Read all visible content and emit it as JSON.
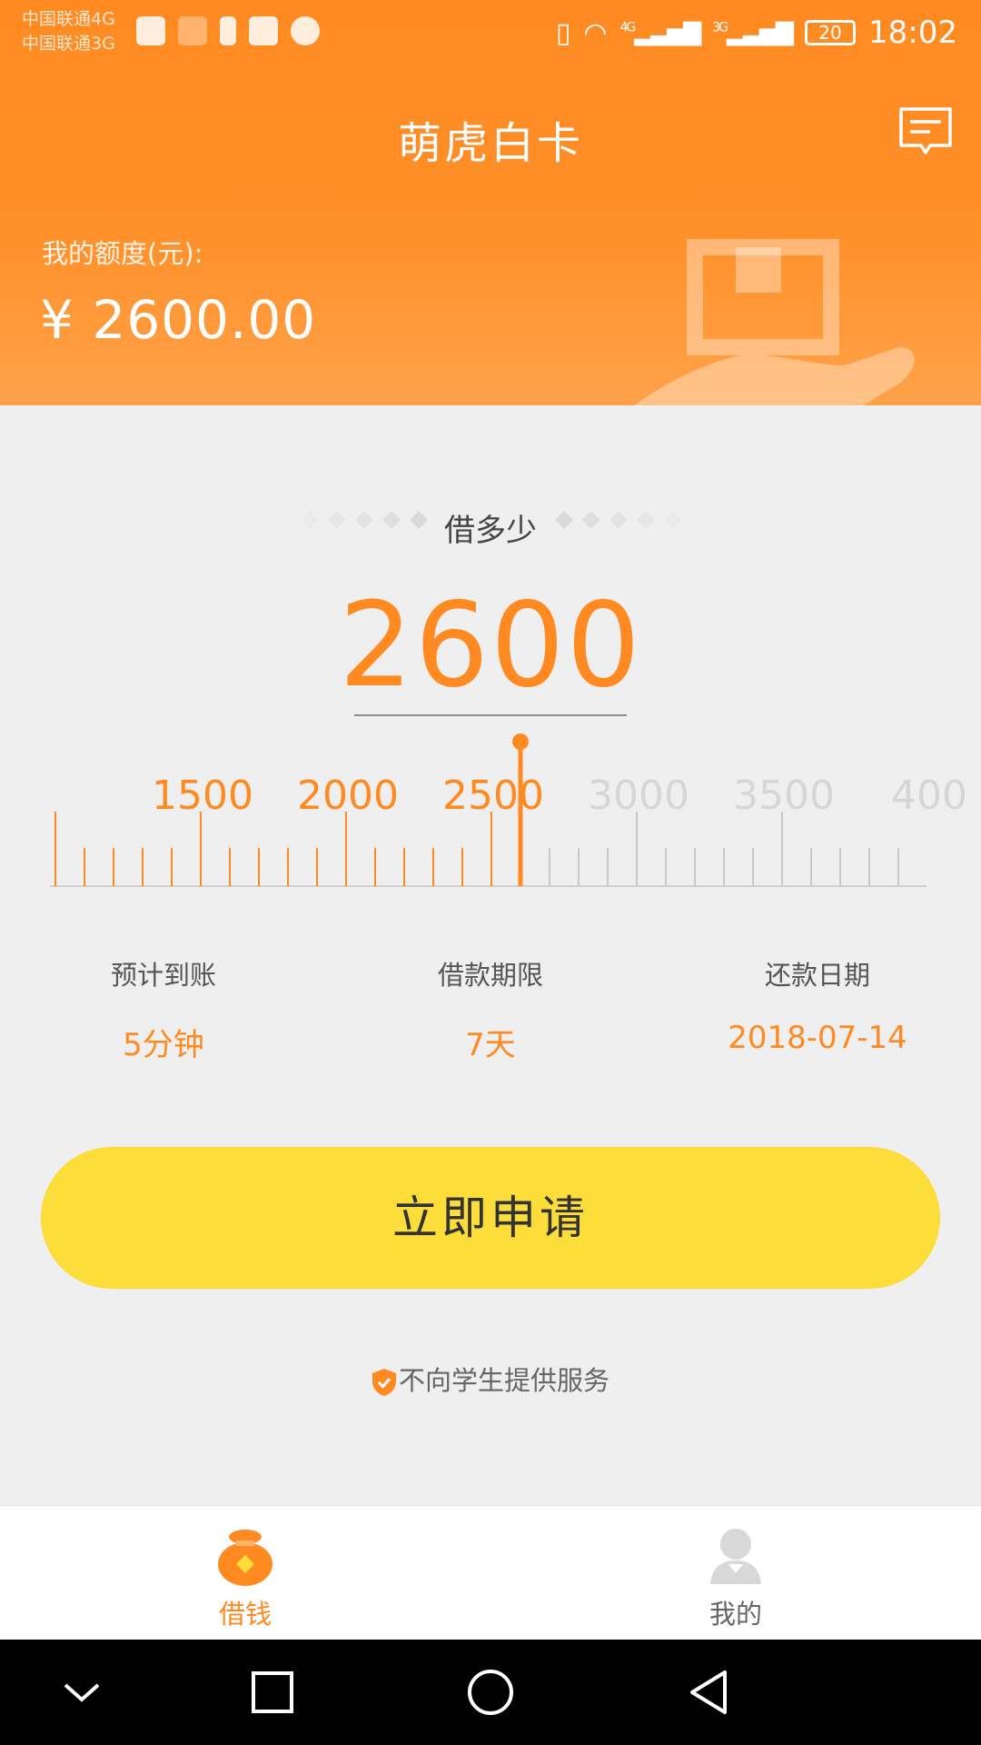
{
  "status_bar": {
    "carrier_1": "中国联通4G",
    "carrier_2": "中国联通3G",
    "signal_1": "4G",
    "signal_2": "3G",
    "battery": "20",
    "time": "18:02"
  },
  "header": {
    "title": "萌虎白卡",
    "credit_label": "我的额度(元):",
    "credit_value": "¥ 2600.00"
  },
  "borrow": {
    "section_title": "借多少",
    "amount": "2600",
    "slider": {
      "min": 1000,
      "max": 4000,
      "value": 2600,
      "tick_step": 100,
      "labels": [
        "1500",
        "2000",
        "2500",
        "3000",
        "3500",
        "400"
      ]
    }
  },
  "info": [
    {
      "label": "预计到账",
      "value": "5分钟"
    },
    {
      "label": "借款期限",
      "value": "7天"
    },
    {
      "label": "还款日期",
      "value": "2018-07-14"
    }
  ],
  "apply_button": "立即申请",
  "notice": "不向学生提供服务",
  "tabbar": {
    "borrow": "借钱",
    "mine": "我的"
  },
  "colors": {
    "accent": "#ff8a22",
    "button": "#fddd3a",
    "inactive_tick": "#c8c8c8"
  },
  "icons": [
    "message-icon",
    "shield-check-icon",
    "money-bag-icon",
    "user-icon",
    "nav-back-icon",
    "nav-home-icon",
    "nav-recents-icon",
    "nav-down-icon"
  ]
}
